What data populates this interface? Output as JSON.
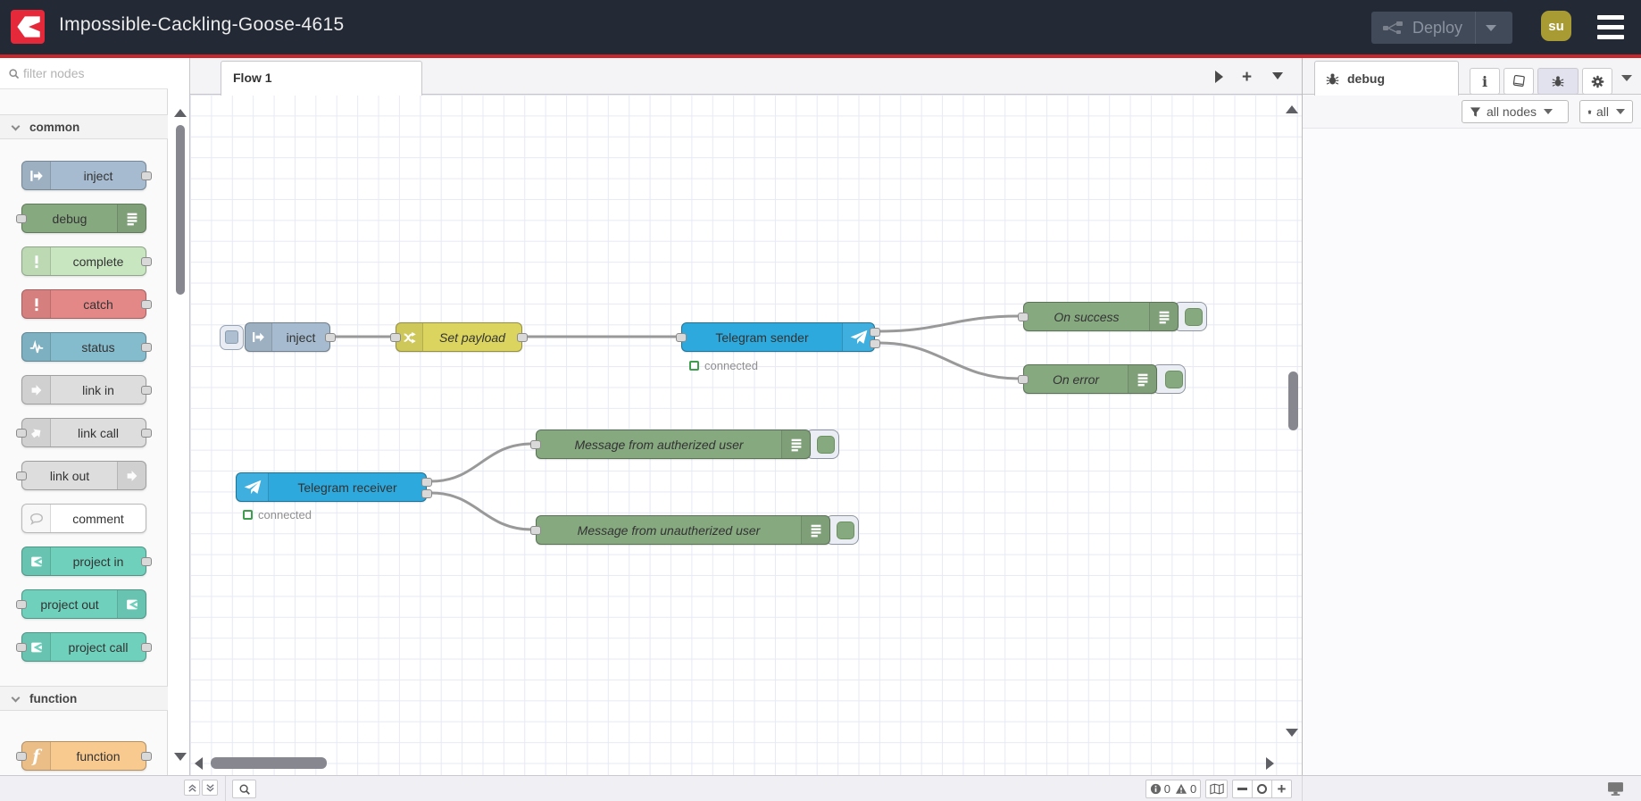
{
  "header": {
    "title": "Impossible-Cackling-Goose-4615",
    "deploy_label": "Deploy",
    "user_initials": "su",
    "colors": {
      "bar": "#232a36",
      "accent_line": "#c9252d",
      "logo_red": "#e5293a",
      "avatar": "#a89b33"
    }
  },
  "palette": {
    "search_placeholder": "filter nodes",
    "categories": [
      {
        "label": "common",
        "nodes": [
          {
            "label": "inject",
            "color": "#a6bbcf",
            "icon": "inject-icon"
          },
          {
            "label": "debug",
            "color": "#87a980",
            "icon": "list-icon"
          },
          {
            "label": "complete",
            "color": "#c8e7c0",
            "icon": "exclamation-icon"
          },
          {
            "label": "catch",
            "color": "#e38787",
            "icon": "exclamation-icon"
          },
          {
            "label": "status",
            "color": "#85bccd",
            "icon": "pulse-icon"
          },
          {
            "label": "link in",
            "color": "#dddddd",
            "icon": "link-icon"
          },
          {
            "label": "link call",
            "color": "#dddddd",
            "icon": "link-icon"
          },
          {
            "label": "link out",
            "color": "#dddddd",
            "icon": "link-icon"
          },
          {
            "label": "comment",
            "color": "#ffffff",
            "icon": "comment-icon"
          },
          {
            "label": "project in",
            "color": "#6fd0bc",
            "icon": "project-icon"
          },
          {
            "label": "project out",
            "color": "#6fd0bc",
            "icon": "project-icon"
          },
          {
            "label": "project call",
            "color": "#6fd0bc",
            "icon": "project-icon"
          }
        ]
      },
      {
        "label": "function",
        "nodes": [
          {
            "label": "function",
            "color": "#f9ca8f",
            "icon": "function-icon"
          }
        ]
      }
    ]
  },
  "workspace": {
    "tabs": [
      {
        "label": "Flow 1"
      }
    ],
    "flow_nodes": [
      {
        "label": "inject",
        "color": "#a6bbcf"
      },
      {
        "label": "Set payload",
        "color": "#dbd45f"
      },
      {
        "label": "Telegram sender",
        "color": "#2ea9dd",
        "status": "connected"
      },
      {
        "label": "On success",
        "color": "#87a980"
      },
      {
        "label": "On error",
        "color": "#87a980"
      },
      {
        "label": "Telegram receiver",
        "color": "#2ea9dd",
        "status": "connected"
      },
      {
        "label": "Message from autherized user",
        "color": "#87a980"
      },
      {
        "label": "Message from unautherized user",
        "color": "#87a980"
      }
    ]
  },
  "sidebar": {
    "tab_label": "debug",
    "filter_button": "all nodes",
    "clear_button": "all"
  },
  "footer": {
    "error_count": "0",
    "warning_count": "0"
  }
}
